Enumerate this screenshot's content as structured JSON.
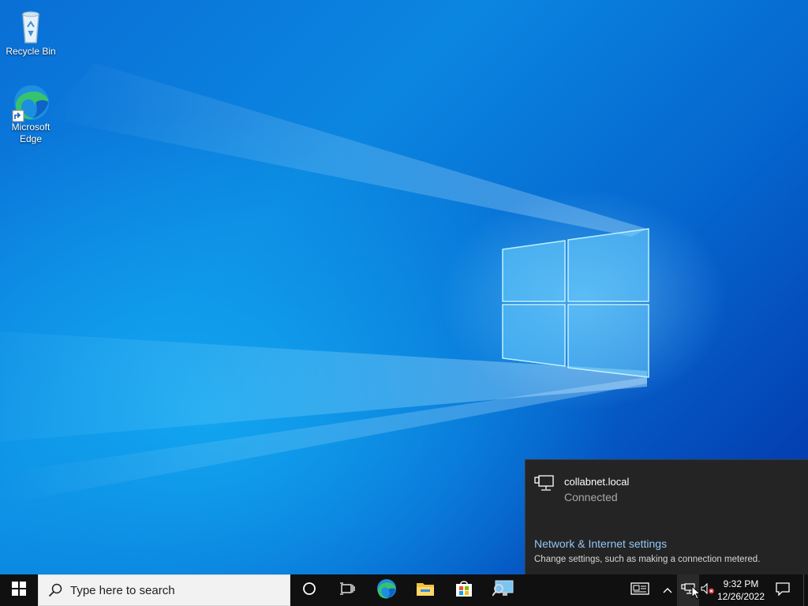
{
  "desktop": {
    "icons": [
      {
        "label": "Recycle Bin"
      },
      {
        "label": "Microsoft\nEdge"
      }
    ]
  },
  "taskbar": {
    "search_placeholder": "Type here to search",
    "pinned": [
      "cortana-icon",
      "task-view-icon",
      "edge-icon",
      "file-explorer-icon",
      "store-icon",
      "remote-desktop-icon"
    ],
    "clock_time": "9:32 PM",
    "clock_date": "12/26/2022"
  },
  "network_flyout": {
    "network_name": "collabnet.local",
    "status": "Connected",
    "settings_link": "Network & Internet settings",
    "settings_desc": "Change settings, such as making a connection metered."
  },
  "colors": {
    "taskbar": "#101010",
    "flyout_bg": "#242424",
    "link": "#93c7f5",
    "desktop_accent": "#0b86e0"
  }
}
